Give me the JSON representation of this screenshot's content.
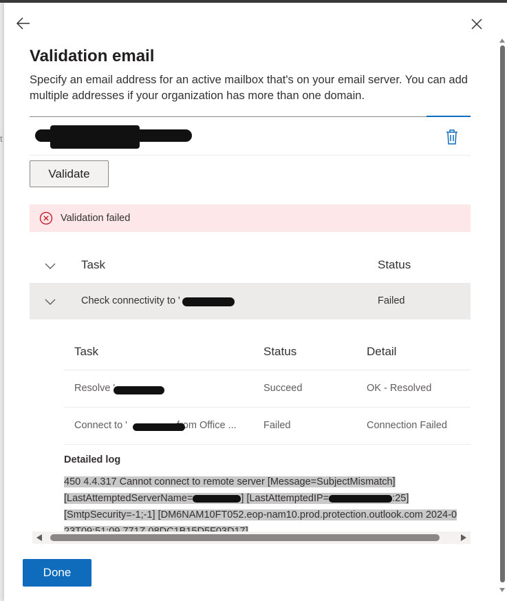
{
  "background_fragment": "t",
  "panel": {
    "title": "Validation email",
    "description": "Specify an email address for an active mailbox that's on your email server. You can add multiple addresses if your organization has more than one domain."
  },
  "validate_label": "Validate",
  "status_banner": {
    "text": "Validation failed",
    "icon": "error-circle-icon"
  },
  "tasks_table": {
    "columns": [
      "Task",
      "Status"
    ],
    "group": {
      "task": "Check connectivity to '",
      "status": "Failed"
    }
  },
  "sub_table": {
    "columns": [
      "Task",
      "Status",
      "Detail"
    ],
    "rows": [
      {
        "task_prefix": "Resolve '",
        "task_suffix": "",
        "status": "Succeed",
        "detail": "OK - Resolved"
      },
      {
        "task_prefix": "Connect to '",
        "task_suffix": "from Office ...",
        "status": "Failed",
        "detail": "Connection Failed"
      }
    ]
  },
  "log": {
    "label": "Detailed log",
    "line1": "450 4.4.317 Cannot connect to remote server [Message=SubjectMismatch]",
    "line2a": "[LastAttemptedServerName=",
    "line2b": "] [LastAttemptedIP=",
    "line2c": ":25]",
    "line3": "[SmtpSecurity=-1;-1] [DM6NAM10FT052.eop-nam10.prod.protection.outlook.com 2024-0",
    "line4": "23T09:51:09.771Z 08DC1B15D5F03D17]"
  },
  "done_label": "Done",
  "colors": {
    "primary": "#0f6cbd",
    "error_bg": "#fde7e9",
    "error_icon": "#c50f1f"
  }
}
